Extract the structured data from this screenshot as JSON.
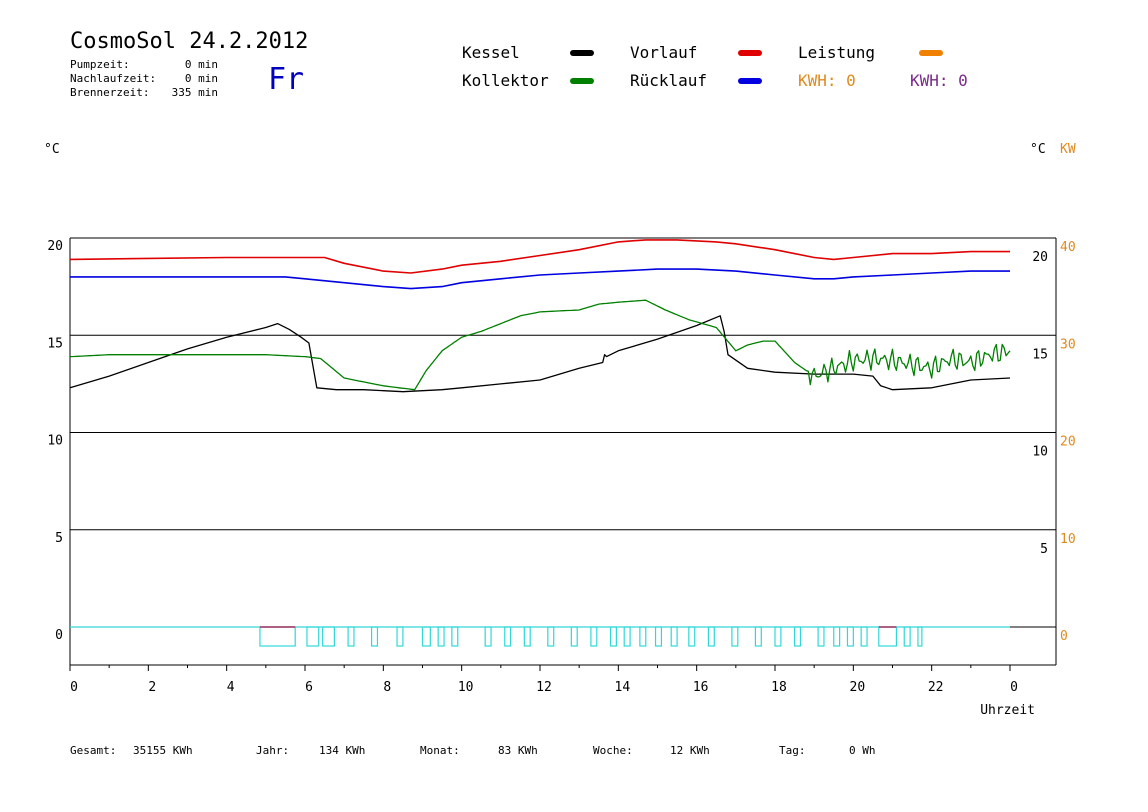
{
  "header": {
    "title": "CosmoSol 24.2.2012",
    "day": "Fr",
    "stats": [
      {
        "label": "Pumpzeit:",
        "value": "0 min"
      },
      {
        "label": "Nachlaufzeit:",
        "value": "0 min"
      },
      {
        "label": "Brennerzeit:",
        "value": "335 min"
      }
    ]
  },
  "legend": {
    "items": [
      {
        "name": "Kessel",
        "color": "#000000"
      },
      {
        "name": "Kollektor",
        "color": "#008000"
      },
      {
        "name": "Vorlauf",
        "color": "#e00000"
      },
      {
        "name": "Rücklauf",
        "color": "#0000e0"
      },
      {
        "name": "Leistung",
        "color": "#f08000"
      }
    ],
    "kwh_orange": "KWH: 0",
    "kwh_purple": "KWH: 0"
  },
  "units": {
    "left": "°C",
    "right_c": "°C",
    "right_kw": "KW"
  },
  "footer": [
    {
      "label": "Gesamt:",
      "value": "35155 KWh"
    },
    {
      "label": "Jahr:",
      "value": "134 KWh"
    },
    {
      "label": "Monat:",
      "value": "83 KWh"
    },
    {
      "label": "Woche:",
      "value": "12 KWh"
    },
    {
      "label": "Tag:",
      "value": "0 Wh"
    }
  ],
  "chart_data": {
    "type": "line",
    "xlabel": "Uhrzeit",
    "x_ticks": [
      "0",
      "2",
      "4",
      "6",
      "8",
      "10",
      "12",
      "14",
      "16",
      "18",
      "20",
      "22",
      "0"
    ],
    "xlim": [
      0,
      24
    ],
    "y_left_ticks": [
      "20",
      "15",
      "10",
      "5",
      "0"
    ],
    "y_right_c_ticks": [
      "20",
      "15",
      "10",
      "5"
    ],
    "y_right_kw_ticks": [
      "40",
      "30",
      "20",
      "10",
      "0"
    ],
    "ylim": [
      -1.5,
      20
    ],
    "grid": true,
    "series": [
      {
        "name": "Vorlauf",
        "color": "#e00000",
        "x": [
          0,
          2,
          4,
          6,
          6.5,
          7,
          8,
          8.7,
          9.5,
          10,
          11,
          12,
          13,
          14,
          14.7,
          15.5,
          16.5,
          17,
          18,
          19,
          19.5,
          20,
          21,
          22,
          23,
          24
        ],
        "y": [
          18.9,
          18.95,
          19.0,
          19.0,
          19.0,
          18.7,
          18.3,
          18.2,
          18.4,
          18.6,
          18.8,
          19.1,
          19.4,
          19.8,
          19.9,
          19.9,
          19.8,
          19.7,
          19.4,
          19.0,
          18.9,
          19.0,
          19.2,
          19.2,
          19.3,
          19.3
        ]
      },
      {
        "name": "Rücklauf",
        "color": "#0000e0",
        "x": [
          0,
          2,
          4,
          5.5,
          6,
          7,
          8,
          8.7,
          9.5,
          10,
          11,
          12,
          13,
          14,
          15,
          16,
          17,
          18,
          19,
          19.5,
          20,
          21,
          22,
          23,
          24
        ],
        "y": [
          18.0,
          18.0,
          18.0,
          18.0,
          17.9,
          17.7,
          17.5,
          17.4,
          17.5,
          17.7,
          17.9,
          18.1,
          18.2,
          18.3,
          18.4,
          18.4,
          18.3,
          18.1,
          17.9,
          17.9,
          18.0,
          18.1,
          18.2,
          18.3,
          18.3
        ]
      },
      {
        "name": "Kessel",
        "color": "#000000",
        "x": [
          0,
          1,
          2,
          3,
          4,
          5,
          5.3,
          5.6,
          5.9,
          6.1,
          6.3,
          6.8,
          7.5,
          8.5,
          9.5,
          10,
          11,
          12,
          13,
          13.6,
          13.65,
          13.7,
          14,
          15,
          16,
          16.6,
          16.7,
          16.8,
          17.3,
          18,
          19,
          20,
          20.5,
          20.7,
          21,
          22,
          23,
          24
        ],
        "y": [
          12.3,
          12.9,
          13.6,
          14.3,
          14.9,
          15.4,
          15.6,
          15.3,
          14.9,
          14.6,
          12.3,
          12.2,
          12.2,
          12.1,
          12.2,
          12.3,
          12.5,
          12.7,
          13.3,
          13.6,
          14.0,
          13.9,
          14.2,
          14.8,
          15.5,
          16.0,
          15.2,
          14.0,
          13.3,
          13.1,
          13.0,
          13.0,
          12.9,
          12.4,
          12.2,
          12.3,
          12.7,
          12.8
        ]
      },
      {
        "name": "Kollektor",
        "color": "#008000",
        "x": [
          0,
          1,
          2,
          3,
          4,
          5,
          6,
          6.4,
          7,
          8,
          8.8,
          9.1,
          9.5,
          10,
          10.5,
          11,
          11.5,
          12,
          13,
          13.5,
          14,
          14.7,
          15.2,
          15.8,
          16.5,
          17,
          17.3,
          17.7,
          18,
          18.5,
          19,
          19.5,
          20,
          20.5,
          21,
          21.5,
          22,
          22.5,
          23,
          23.5,
          24
        ],
        "y": [
          13.9,
          14.0,
          14.0,
          14.0,
          14.0,
          14.0,
          13.9,
          13.8,
          12.8,
          12.4,
          12.2,
          13.2,
          14.2,
          14.9,
          15.2,
          15.6,
          16.0,
          16.2,
          16.3,
          16.6,
          16.7,
          16.8,
          16.3,
          15.8,
          15.4,
          14.2,
          14.5,
          14.7,
          14.7,
          13.6,
          12.9,
          13.3,
          13.7,
          13.8,
          13.7,
          13.5,
          13.3,
          13.8,
          13.6,
          14.0,
          14.2
        ]
      }
    ],
    "pump_pulses": [
      {
        "start": 4.85,
        "end": 5.75
      },
      {
        "start": 6.05,
        "end": 6.35
      },
      {
        "start": 6.45,
        "end": 6.75
      },
      {
        "start": 7.1,
        "end": 7.25
      },
      {
        "start": 7.7,
        "end": 7.85
      },
      {
        "start": 8.35,
        "end": 8.5
      },
      {
        "start": 9.0,
        "end": 9.2
      },
      {
        "start": 9.4,
        "end": 9.55
      },
      {
        "start": 9.75,
        "end": 9.9
      },
      {
        "start": 10.6,
        "end": 10.75
      },
      {
        "start": 11.1,
        "end": 11.25
      },
      {
        "start": 11.6,
        "end": 11.75
      },
      {
        "start": 12.2,
        "end": 12.35
      },
      {
        "start": 12.8,
        "end": 12.95
      },
      {
        "start": 13.3,
        "end": 13.45
      },
      {
        "start": 13.8,
        "end": 13.95
      },
      {
        "start": 14.15,
        "end": 14.3
      },
      {
        "start": 14.55,
        "end": 14.7
      },
      {
        "start": 14.95,
        "end": 15.1
      },
      {
        "start": 15.35,
        "end": 15.5
      },
      {
        "start": 15.8,
        "end": 15.95
      },
      {
        "start": 16.3,
        "end": 16.45
      },
      {
        "start": 16.9,
        "end": 17.05
      },
      {
        "start": 17.5,
        "end": 17.65
      },
      {
        "start": 18.0,
        "end": 18.15
      },
      {
        "start": 18.5,
        "end": 18.65
      },
      {
        "start": 19.1,
        "end": 19.25
      },
      {
        "start": 19.5,
        "end": 19.65
      },
      {
        "start": 19.85,
        "end": 20.0
      },
      {
        "start": 20.2,
        "end": 20.35
      },
      {
        "start": 20.65,
        "end": 21.1
      },
      {
        "start": 21.3,
        "end": 21.45
      },
      {
        "start": 21.65,
        "end": 21.75
      }
    ]
  }
}
